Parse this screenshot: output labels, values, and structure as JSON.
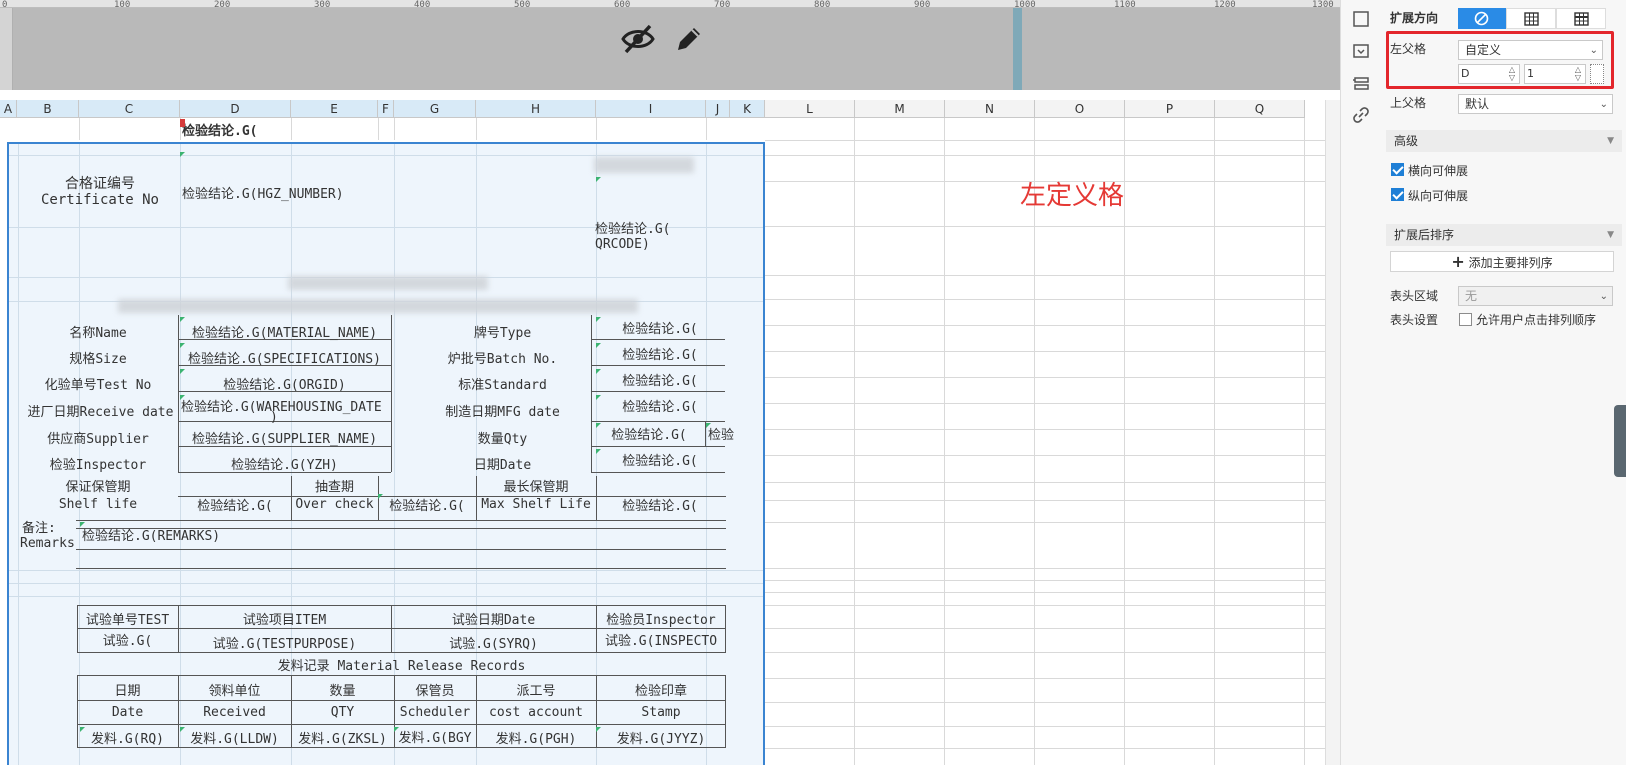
{
  "ruler": {
    "ticks": [
      "0",
      "100",
      "200",
      "300",
      "400",
      "500",
      "600",
      "700",
      "800",
      "900",
      "1000",
      "1100",
      "1200",
      "1300"
    ]
  },
  "toolbar": {
    "hide_icon": "eye-slash-icon",
    "edit_icon": "pencil-icon"
  },
  "columns": [
    "A",
    "B",
    "C",
    "D",
    "E",
    "F",
    "G",
    "H",
    "I",
    "J",
    "K",
    "L",
    "M",
    "N",
    "O",
    "P",
    "Q"
  ],
  "annotation": "左定义格",
  "cells": {
    "top_formula": "检验结论.G(",
    "cert_label_cn": "合格证编号",
    "cert_label_en": "Certificate No",
    "cert_value": "检验结论.G(HGZ_NUMBER)",
    "qr_value_1": "检验结论.G(",
    "qr_value_2": "QRCODE)",
    "blurred_code": "ZH0016",
    "name_label": "名称Name",
    "name_value": "检验结论.G(MATERIAL_NAME)",
    "type_label": "牌号Type",
    "type_value": "检验结论.G(",
    "size_label": "规格Size",
    "size_value": "检验结论.G(SPECIFICATIONS)",
    "batch_label": "炉批号Batch No.",
    "batch_value": "检验结论.G(",
    "test_label": "化验单号Test No",
    "test_value": "检验结论.G(ORGID)",
    "std_label": "标准Standard",
    "std_value": "检验结论.G(",
    "recv_label": "进厂日期Receive date",
    "recv_value_1": "检验结论.G(WAREHOUSING_DATE",
    "recv_value_2": ")",
    "mfg_label": "制造日期MFG date",
    "mfg_value": "检验结论.G(",
    "supplier_label": "供应商Supplier",
    "supplier_value": "检验结论.G(SUPPLIER_NAME)",
    "qty_label": "数量Qty",
    "qty_value": "检验结论.G(",
    "qty_value_2": "检验",
    "inspector_label": "检验Inspector",
    "inspector_value": "检验结论.G(YZH)",
    "date_label": "日期Date",
    "date_value": "检验结论.G(",
    "shelf_cn": "保证保管期",
    "shelf_en": "Shelf life",
    "shelf_value": "检验结论.G(",
    "over_cn": "抽查期",
    "over_en": "Over check",
    "over_value": "检验结论.G(",
    "max_cn": "最长保管期",
    "max_en": "Max Shelf Life",
    "max_value": "检验结论.G(",
    "remarks_cn": "备注:",
    "remarks_en": "Remarks",
    "remarks_value": "检验结论.G(REMARKS)",
    "t_test_no": "试验单号TEST",
    "t_item": "试验项目ITEM",
    "t_date": "试验日期Date",
    "t_inspector": "检验员Inspector",
    "t_v1": "试验.G(",
    "t_v2": "试验.G(TESTPURPOSE)",
    "t_v3": "试验.G(SYRQ)",
    "t_v4": "试验.G(INSPECTO",
    "release_title": "发料记录 Material Release Records",
    "r_h1_cn": "日期",
    "r_h1_en": "Date",
    "r_h2_cn": "领料单位",
    "r_h2_en": "Received",
    "r_h3_cn": "数量",
    "r_h3_en": "QTY",
    "r_h4_cn": "保管员",
    "r_h4_en": "Scheduler",
    "r_h5_cn": "派工号",
    "r_h5_en": "cost account",
    "r_h6_cn": "检验印章",
    "r_h6_en": "Stamp",
    "r_v1": "发料.G(RQ)",
    "r_v2": "发料.G(LLDW)",
    "r_v3": "发料.G(ZKSL)",
    "r_v4": "发料.G(BGY",
    "r_v5": "发料.G(PGH)",
    "r_v6": "发料.G(JYYZ)"
  },
  "panel": {
    "expand_dir_label": "扩展方向",
    "left_parent_label": "左父格",
    "left_parent_value": "自定义",
    "col_input": "D",
    "row_input": "1",
    "upper_parent_label": "上父格",
    "upper_parent_value": "默认",
    "advanced_label": "高级",
    "h_expand_label": "横向可伸展",
    "v_expand_label": "纵向可伸展",
    "sort_label": "扩展后排序",
    "add_sort_label": "添加主要排列序",
    "header_area_label": "表头区域",
    "header_area_value": "无",
    "header_setting_label": "表头设置",
    "allow_sort_label": "允许用户点击排列顺序"
  },
  "colors": {
    "accent": "#1e7fd6",
    "annotation": "#e53935",
    "highlight_box": "#e3262c",
    "selection": "#3a84d1"
  }
}
